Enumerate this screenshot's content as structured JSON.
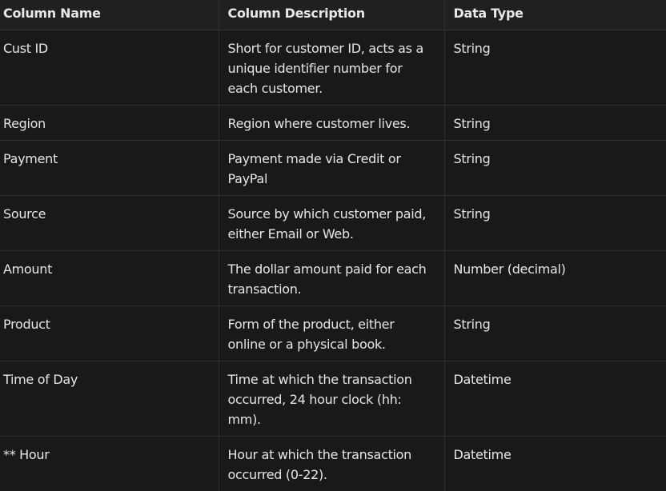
{
  "table": {
    "headers": [
      "Column Name",
      "Column Description",
      "Data Type"
    ],
    "rows": [
      {
        "name": "Cust ID",
        "description": "Short for customer ID, acts as a unique identifier number for each customer.",
        "type": "String"
      },
      {
        "name": "Region",
        "description": "Region where customer lives.",
        "type": "String"
      },
      {
        "name": "Payment",
        "description": "Payment made via Credit or PayPal",
        "type": "String"
      },
      {
        "name": "Source",
        "description": "Source by which customer paid, either Email or Web.",
        "type": "String"
      },
      {
        "name": "Amount",
        "description": "The dollar amount paid for each transaction.",
        "type": "Number (decimal)"
      },
      {
        "name": "Product",
        "description": "Form of the product, either online or a physical book.",
        "type": "String"
      },
      {
        "name": "Time of Day",
        "description": "Time at which the transaction occurred, 24 hour clock (hh: mm).",
        "type": "Datetime"
      },
      {
        "name": "** Hour",
        "description": "Hour at which the transaction occurred (0-22).",
        "type": "Datetime"
      }
    ]
  }
}
